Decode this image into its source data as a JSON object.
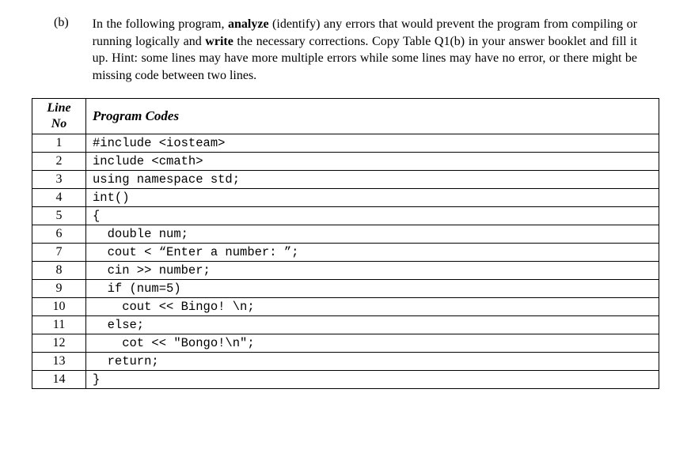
{
  "question": {
    "label": "(b)",
    "text_before_analyze": "In the following program, ",
    "analyze_word": "analyze",
    "identify_phrase": " (identify)",
    "text_after_identify": " any errors that would prevent the program from compiling or running logically and ",
    "write_word": "write",
    "text_after_write": " the necessary corrections. Copy Table Q1(b) in your answer booklet and fill it up. Hint: some lines may have more multiple errors while some lines may have no error, or there might be missing code between two lines."
  },
  "table": {
    "header_lineno_line1": "Line",
    "header_lineno_line2": "No",
    "header_codes": "Program Codes",
    "rows": [
      {
        "no": "1",
        "code": "#include <iosteam>"
      },
      {
        "no": "2",
        "code": "include <cmath>"
      },
      {
        "no": "3",
        "code": "using namespace std;"
      },
      {
        "no": "4",
        "code": "int()"
      },
      {
        "no": "5",
        "code": "{"
      },
      {
        "no": "6",
        "code": "  double num;"
      },
      {
        "no": "7",
        "code": "  cout < “Enter a number: ”;"
      },
      {
        "no": "8",
        "code": "  cin >> number;"
      },
      {
        "no": "9",
        "code": "  if (num=5)"
      },
      {
        "no": "10",
        "code": "    cout << Bingo! \\n;"
      },
      {
        "no": "11",
        "code": "  else;"
      },
      {
        "no": "12",
        "code": "    cot << \"Bongo!\\n\";"
      },
      {
        "no": "13",
        "code": "  return;"
      },
      {
        "no": "14",
        "code": "}"
      }
    ]
  }
}
